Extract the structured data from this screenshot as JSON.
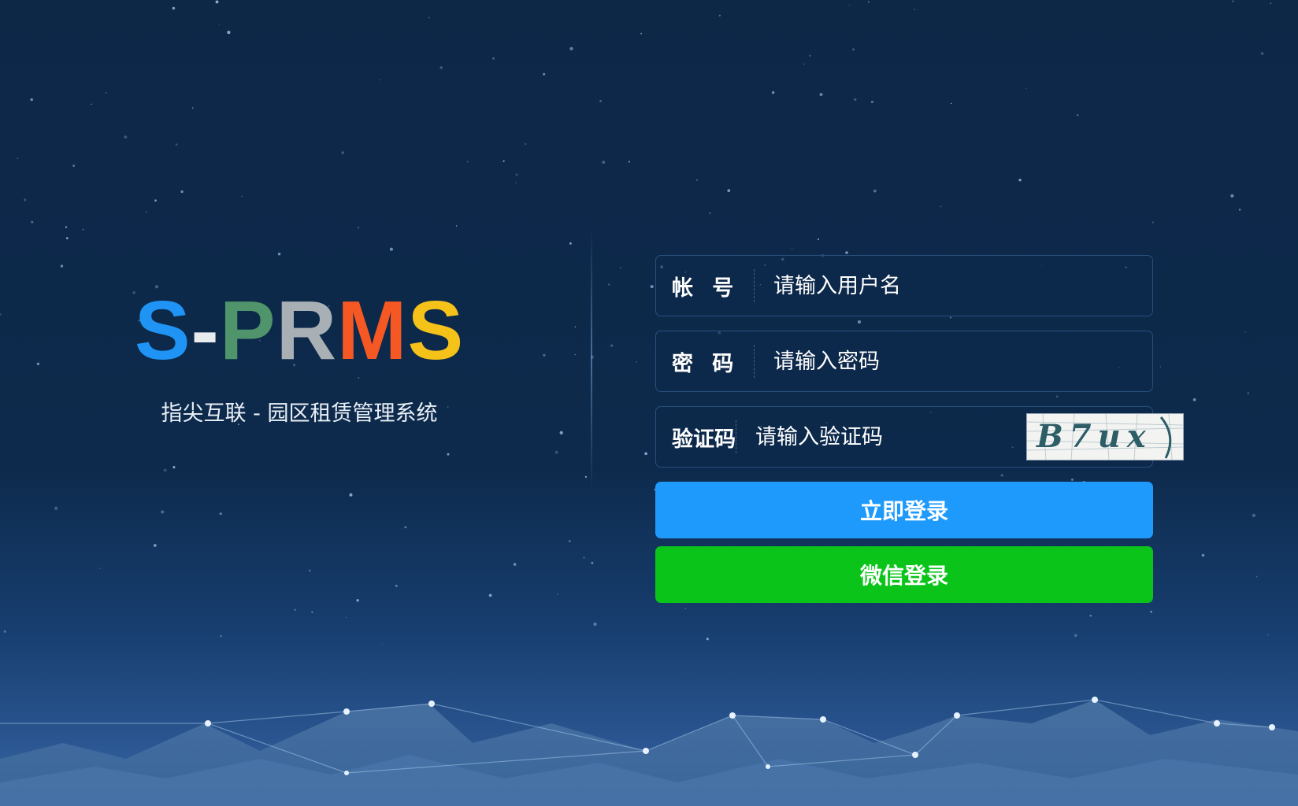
{
  "brand": {
    "logo_letters": [
      {
        "char": "S",
        "color": "#1f94f4"
      },
      {
        "char": "-",
        "color": "#e8ecef"
      },
      {
        "char": "P",
        "color": "#4f946a"
      },
      {
        "char": "R",
        "color": "#a8b0b5"
      },
      {
        "char": "M",
        "color": "#f65823"
      },
      {
        "char": "S",
        "color": "#f5c21a"
      }
    ],
    "subtitle": "指尖互联 - 园区租赁管理系统"
  },
  "form": {
    "username": {
      "label": "帐号",
      "placeholder": "请输入用户名",
      "value": ""
    },
    "password": {
      "label": "密码",
      "placeholder": "请输入密码",
      "value": ""
    },
    "captcha": {
      "label": "验证码",
      "placeholder": "请输入验证码",
      "value": "",
      "image_text": "B7ux"
    },
    "login_button": "立即登录",
    "wechat_button": "微信登录"
  },
  "colors": {
    "background": "#0d2747",
    "field_border": "#2a4f7d",
    "login_button": "#1e9afc",
    "wechat_button": "#0ac41a"
  }
}
